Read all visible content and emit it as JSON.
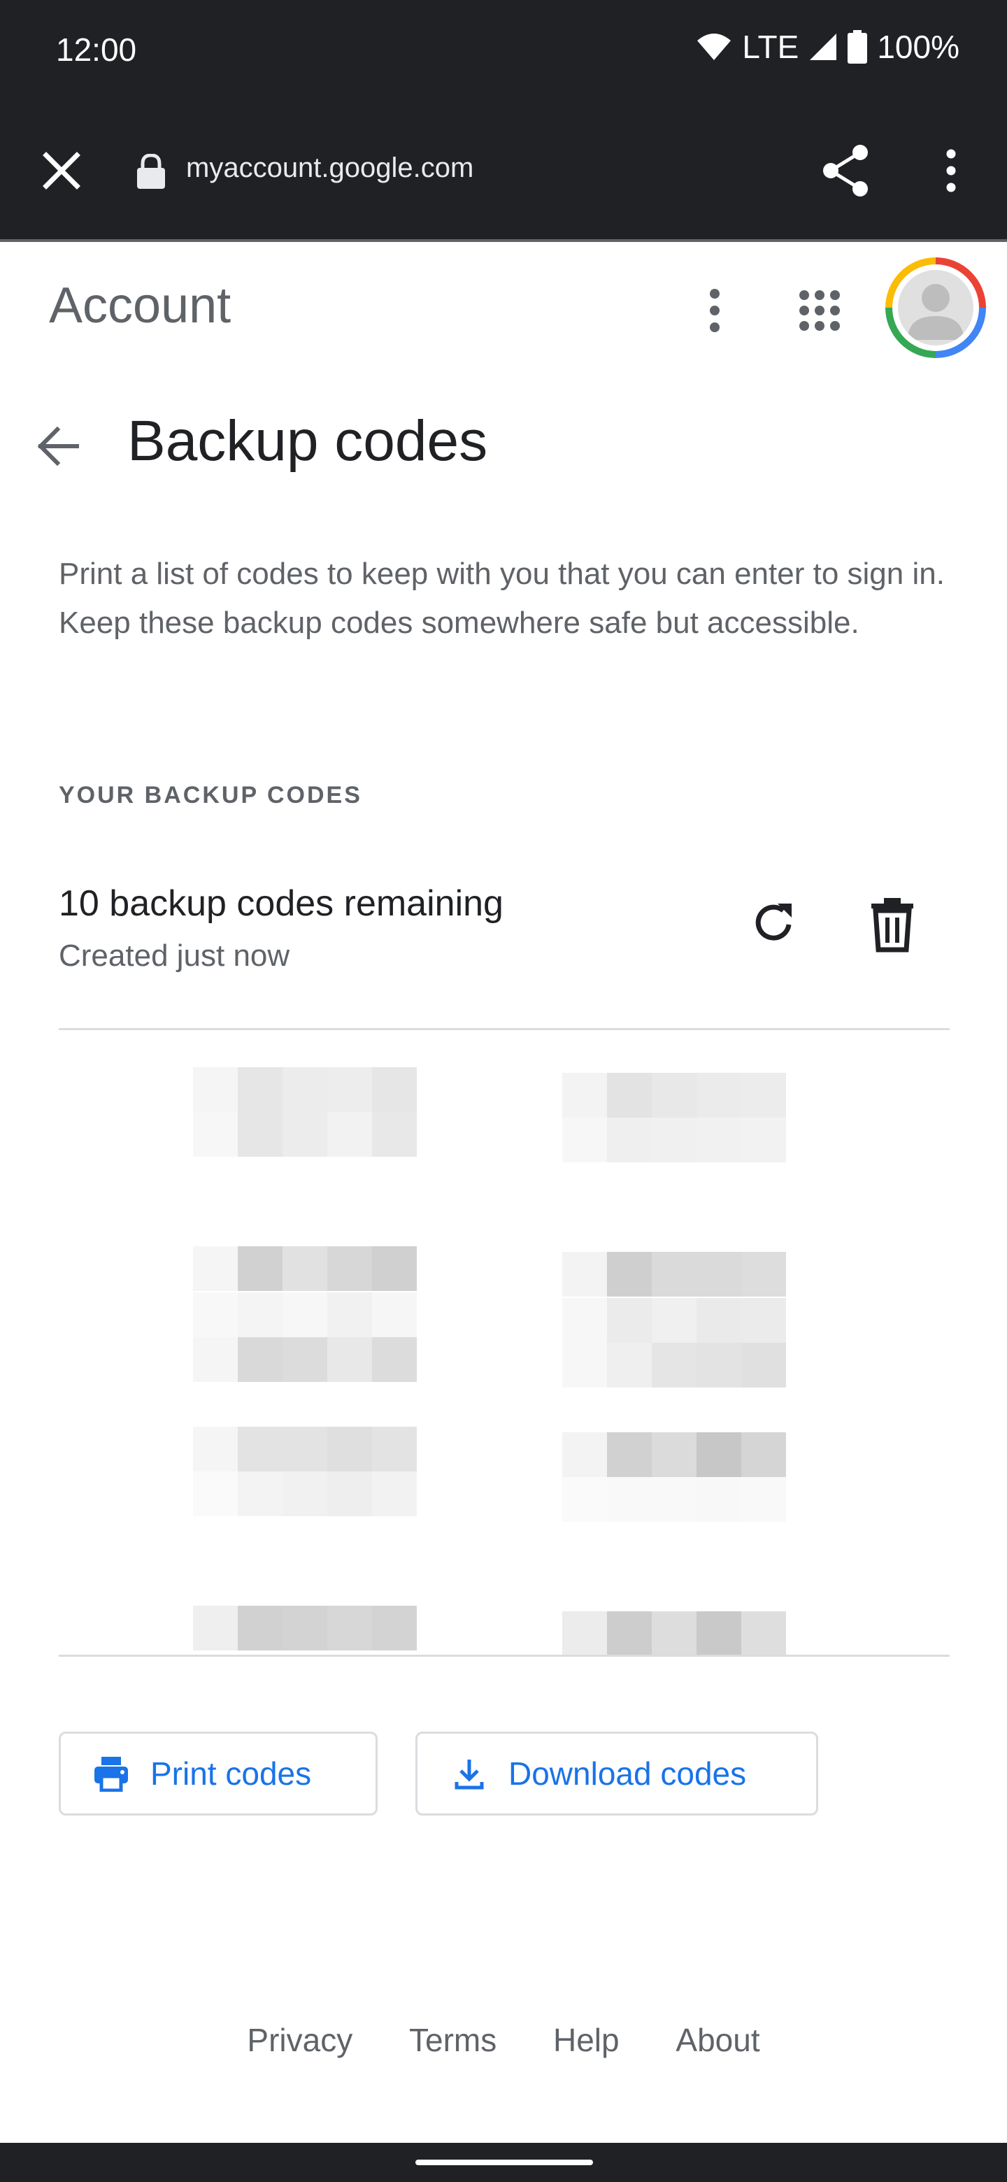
{
  "status_bar": {
    "time": "12:00",
    "network": "LTE",
    "battery": "100%",
    "icons": [
      "wifi-icon",
      "signal-icon",
      "battery-icon"
    ]
  },
  "browser": {
    "url": "myaccount.google.com",
    "icons": [
      "close-icon",
      "lock-icon",
      "share-icon",
      "more-vert-icon"
    ]
  },
  "app_header": {
    "title": "Account",
    "icons": [
      "more-vert-icon",
      "apps-grid-icon",
      "avatar"
    ]
  },
  "page": {
    "title": "Backup codes",
    "description": "Print a list of codes to keep with you that you can enter to sign in. Keep these backup codes somewhere safe but accessible.",
    "section_label": "YOUR BACKUP CODES",
    "remaining": "10 backup codes remaining",
    "created": "Created just now"
  },
  "codes": {
    "count": 10,
    "state": "obscured",
    "shades": [
      [
        [
          "#f5f5f5",
          "#e6e6e6",
          "#ececec",
          "#ededed",
          "#e6e6e6"
        ],
        [
          "#f7f7f7",
          "#e6e6e6",
          "#ececec",
          "#f2f2f2",
          "#e8e8e8"
        ]
      ],
      [
        [
          "#f3f3f3",
          "#e3e3e3",
          "#e8e8e8",
          "#ebebeb",
          "#ececec"
        ],
        [
          "#f7f7f7",
          "#efefef",
          "#f0f0f0",
          "#f1f1f1",
          "#f2f2f2"
        ]
      ],
      [
        [
          "#ffffff",
          "#ffffff",
          "#ffffff",
          "#ffffff",
          "#ffffff"
        ],
        [
          "#f5f5f5",
          "#d1d1d1",
          "#e1e1e1",
          "#d7d7d7",
          "#d0d0d0"
        ]
      ],
      [
        [
          "#ffffff",
          "#ffffff",
          "#ffffff",
          "#ffffff",
          "#ffffff"
        ],
        [
          "#f3f3f3",
          "#cfcfcf",
          "#dadada",
          "#dadada",
          "#dddddd"
        ]
      ],
      [
        [
          "#f8f8f8",
          "#f4f4f4",
          "#f7f7f7",
          "#f1f1f1",
          "#f6f6f6"
        ],
        [
          "#f5f5f5",
          "#d9d9d9",
          "#dcdcdc",
          "#e8e8e8",
          "#dcdcdc"
        ]
      ],
      [
        [
          "#f7f7f7",
          "#ebebeb",
          "#f0f0f0",
          "#eaeaea",
          "#ebebeb"
        ],
        [
          "#f7f7f7",
          "#efefef",
          "#e5e5e5",
          "#e3e3e3",
          "#e0e0e0"
        ]
      ],
      [
        [
          "#f5f5f5",
          "#e3e3e3",
          "#e3e3e3",
          "#dfdfdf",
          "#e3e3e3"
        ],
        [
          "#fafafa",
          "#f3f3f3",
          "#f1f1f1",
          "#eeeeee",
          "#f2f2f2"
        ]
      ],
      [
        [
          "#f3f3f3",
          "#d1d1d1",
          "#dbdbdb",
          "#c7c7c7",
          "#d5d5d5"
        ],
        [
          "#fafafa",
          "#f9f9f9",
          "#f9f9f9",
          "#f8f8f8",
          "#f9f9f9"
        ]
      ],
      [
        [
          "#ffffff",
          "#ffffff",
          "#ffffff",
          "#ffffff",
          "#ffffff"
        ],
        [
          "#efefef",
          "#d1d1d1",
          "#d3d3d3",
          "#d7d7d7",
          "#d3d3d3"
        ]
      ],
      [
        [
          "#ffffff",
          "#ffffff",
          "#ffffff",
          "#ffffff",
          "#ffffff"
        ],
        [
          "#ececec",
          "#cdcdcd",
          "#dddddd",
          "#c9c9c9",
          "#dedede"
        ]
      ]
    ]
  },
  "actions": {
    "print_label": "Print codes",
    "download_label": "Download codes",
    "icons": [
      "print-icon",
      "download-icon",
      "refresh-icon",
      "delete-icon"
    ]
  },
  "footer": {
    "links": [
      "Privacy",
      "Terms",
      "Help",
      "About"
    ]
  },
  "colors": {
    "accent": "#1a73e8",
    "dark_bar": "#202124",
    "secondary_text": "#5f6368",
    "divider": "#dadce0"
  }
}
